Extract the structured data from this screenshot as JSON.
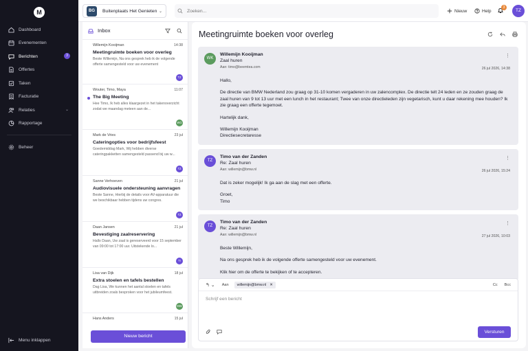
{
  "brand": {
    "logo_letter": "M"
  },
  "colors": {
    "accent": "#6a4fd8",
    "sidebar_bg": "#15151f",
    "avatar_green": "#5b9b5e",
    "org_avatar": "#2d4a6b",
    "notification": "#e8893a"
  },
  "sidebar": {
    "items": [
      {
        "label": "Dashboard",
        "icon": "home-icon"
      },
      {
        "label": "Evenementen",
        "icon": "calendar-icon"
      },
      {
        "label": "Berichten",
        "icon": "message-icon",
        "badge": "3"
      },
      {
        "label": "Offertes",
        "icon": "document-icon"
      },
      {
        "label": "Taken",
        "icon": "checklist-icon"
      },
      {
        "label": "Facturatie",
        "icon": "invoice-icon"
      },
      {
        "label": "Relaties",
        "icon": "users-icon"
      },
      {
        "label": "Rapportage",
        "icon": "chart-icon"
      },
      {
        "label": "Beheer",
        "icon": "gear-icon"
      }
    ],
    "collapse_label": "Menu inklappen"
  },
  "topbar": {
    "org_initials": "BG",
    "org_name": "Buitenplaats Het Genieten",
    "search_placeholder": "Zoeken...",
    "new_label": "Nieuw",
    "help_label": "Help",
    "notification_count": "3",
    "user_initials": "TZ"
  },
  "inbox": {
    "title": "Inbox",
    "new_message_button": "Nieuw bericht",
    "messages": [
      {
        "from": "Willemijn Kooijman",
        "date": "14:38",
        "subject": "Meetingruimte boeken voor overleg",
        "preview": "Beste Willemijn, Na ons gesprek heb ik de volgende offerte samengesteld voor uw evenement",
        "tag": "TZ"
      },
      {
        "from": "Wouter, Timo, Maya",
        "date": "11:07",
        "subject": "The Big Meeting",
        "preview": "Hee Timo, Ik heb alles klaargezet in het takenoverzicht zodat we maandag meteen aan de...",
        "tag": "WG"
      },
      {
        "from": "Mark de Vries",
        "date": "23 jul",
        "subject": "Cateringopties voor bedrijfsfeest",
        "preview": "Goedemiddag Mark, Wij hebben diverse cateringpakketten samengesteld passend bij uw w...",
        "tag": "TZ"
      },
      {
        "from": "Sanne Verhoeven",
        "date": "21 jul",
        "subject": "Audiovisuele ondersteuning aanvragen",
        "preview": "Beste Sanne, Hierbij de details voor AV-apparatuur die we beschikbaar hebben tijdens uw congres.",
        "tag": "TZ"
      },
      {
        "from": "Daan Jansen",
        "date": "21 jul",
        "subject": "Bevestiging zaalreservering",
        "preview": "Hallo Daan, Uw zaal is gereserveerd voor 15 september van 09:00 tot 17:00 uur. Uitstekende lo...",
        "tag": "TI"
      },
      {
        "from": "Lisa van Dijk",
        "date": "18 jul",
        "subject": "Extra stoelen en tafels bestellen",
        "preview": "Dag Lisa, We kunnen het aantal stoelen en tafels uitbreiden zoals besproken voor het jubileumfeest.",
        "tag": "MW"
      },
      {
        "from": "Hans Anders",
        "date": "15 jul",
        "subject": "",
        "preview": "",
        "tag": ""
      }
    ]
  },
  "detail": {
    "title": "Meetingruimte boeken voor overleg",
    "thread": [
      {
        "initials": "WK",
        "sender": "Willemijn Kooijman",
        "subject": "Zaal huren",
        "to": "Aan: timo@beemtea.com",
        "date": "26 jul 2026, 14:38",
        "body": [
          "Hallo,",
          "De directie van BMW Nederland zou graag op 31-10 komen vergaderen in uw zalencomplex. De directie telt 24 leden en ze zouden graag de zaal huren van 9 tot 13 uur met een lunch in het restaurant; Twee van onze directieleden zijn vegetarisch, kunt u daar rekening mee houden? Ik zie graag een offerte tegemoet.",
          "Hartelijk dank,",
          "Willemijn Kooijman\nDirectiesecretaresse"
        ]
      },
      {
        "initials": "TZ",
        "sender": "Timo van der Zanden",
        "subject": "Re: Zaal huren",
        "to": "Aan: willemijn@bmw.nl",
        "date": "26 jul 2026, 15:24",
        "body": [
          "Dat is zeker mogelijk! Ik ga aan de slag met een offerte.",
          "Groet,\nTimo"
        ]
      },
      {
        "initials": "TZ",
        "sender": "Timo van der Zanden",
        "subject": "Re: Zaal huren",
        "to": "Aan: willemijn@bmw.nl",
        "date": "27 jul 2026, 10:03",
        "body": [
          "Beste Willemijn,",
          "Na ons gesprek heb ik de volgende offerte samengesteld voor uw evenement.",
          "Klik hier om de offerte te bekijken of te accepteren."
        ]
      }
    ],
    "reply": {
      "to_label": "Aan",
      "recipient": "willemijn@bmw.nl",
      "cc_label": "Cc",
      "bcc_label": "Bcc",
      "placeholder": "Schrijf een bericht",
      "send_label": "Versturen"
    }
  }
}
